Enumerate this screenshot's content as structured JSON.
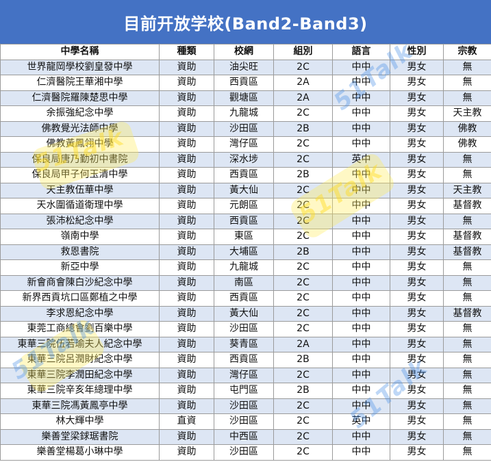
{
  "title": "目前开放学校(Band2-Band3)",
  "columns": [
    "中學名稱",
    "種類",
    "校網",
    "組別",
    "語言",
    "性別",
    "宗教"
  ],
  "rows": [
    [
      "世界龍岡學校劉皇發中學",
      "資助",
      "油尖旺",
      "2C",
      "中中",
      "男女",
      "無"
    ],
    [
      "仁濟醫院王華湘中學",
      "資助",
      "西貢區",
      "2A",
      "中中",
      "男女",
      "無"
    ],
    [
      "仁濟醫院羅陳楚思中學",
      "資助",
      "觀塘區",
      "2A",
      "中中",
      "男女",
      "無"
    ],
    [
      "余振強紀念中學",
      "資助",
      "九龍城",
      "2C",
      "中中",
      "男女",
      "天主教"
    ],
    [
      "佛教覺光法師中學",
      "資助",
      "沙田區",
      "2B",
      "中中",
      "男女",
      "佛教"
    ],
    [
      "佛教黃鳳翎中學",
      "資助",
      "灣仔區",
      "2C",
      "中中",
      "男女",
      "佛教"
    ],
    [
      "保良局唐乃勤初中書院",
      "資助",
      "深水埗",
      "2C",
      "英中",
      "男女",
      "無"
    ],
    [
      "保良局甲子何玉清中學",
      "資助",
      "西貢區",
      "2B",
      "中中",
      "男女",
      "無"
    ],
    [
      "天主教伍華中學",
      "資助",
      "黃大仙",
      "2C",
      "中中",
      "男女",
      "天主教"
    ],
    [
      "天水圍循道衛理中學",
      "資助",
      "元朗區",
      "2C",
      "中中",
      "男女",
      "基督教"
    ],
    [
      "張沛松紀念中學",
      "資助",
      "西貢區",
      "2C",
      "中中",
      "男女",
      "無"
    ],
    [
      "嶺南中學",
      "資助",
      "東區",
      "2C",
      "中中",
      "男女",
      "基督教"
    ],
    [
      "救恩書院",
      "資助",
      "大埔區",
      "2B",
      "中中",
      "男女",
      "基督教"
    ],
    [
      "新亞中學",
      "資助",
      "九龍城",
      "2C",
      "中中",
      "男女",
      "無"
    ],
    [
      "新會商會陳白沙紀念中學",
      "資助",
      "南區",
      "2C",
      "中中",
      "男女",
      "無"
    ],
    [
      "新界西貢坑口區鄭植之中學",
      "資助",
      "西貢區",
      "2C",
      "中中",
      "男女",
      "無"
    ],
    [
      "李求恩紀念中學",
      "資助",
      "黃大仙",
      "2C",
      "中中",
      "男女",
      "基督教"
    ],
    [
      "東莞工商總會劉百樂中學",
      "資助",
      "沙田區",
      "2C",
      "中中",
      "男女",
      "無"
    ],
    [
      "東華三院伍若瑜夫人紀念中學",
      "資助",
      "葵青區",
      "2A",
      "中中",
      "男女",
      "無"
    ],
    [
      "東華三院呂潤財紀念中學",
      "資助",
      "西貢區",
      "2B",
      "中中",
      "男女",
      "無"
    ],
    [
      "東華三院李潤田紀念中學",
      "資助",
      "灣仔區",
      "2C",
      "中中",
      "男女",
      "無"
    ],
    [
      "東華三院辛亥年總理中學",
      "資助",
      "屯門區",
      "2B",
      "中中",
      "男女",
      "無"
    ],
    [
      "東華三院馮黃鳳亭中學",
      "資助",
      "沙田區",
      "2C",
      "中中",
      "男女",
      "無"
    ],
    [
      "林大輝中學",
      "直資",
      "沙田區",
      "2C",
      "英中",
      "男女",
      "無"
    ],
    [
      "樂善堂梁銶琚書院",
      "資助",
      "中西區",
      "2C",
      "中中",
      "男女",
      "無"
    ],
    [
      "樂善堂楊葛小琳中學",
      "資助",
      "沙田區",
      "2C",
      "中中",
      "男女",
      "無"
    ]
  ],
  "watermark": "51Talk",
  "colors": {
    "header_bg": "#4472C4",
    "row_band": "#dde6f4"
  }
}
